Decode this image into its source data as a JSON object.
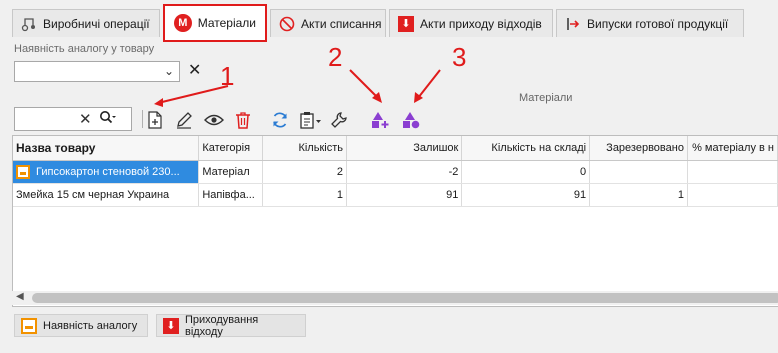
{
  "tabs": [
    {
      "label": "Виробничі операції",
      "icon": "process-icon"
    },
    {
      "label": "Матеріали",
      "icon": "materials-m-icon",
      "active": true
    },
    {
      "label": "Акти списання",
      "icon": "forbidden-icon"
    },
    {
      "label": "Акти приходу відходів",
      "icon": "red-down-arrow-icon"
    },
    {
      "label": "Випуски готової продукції",
      "icon": "release-icon"
    }
  ],
  "filter": {
    "label": "Наявність аналогу у товару",
    "value": ""
  },
  "grid": {
    "title": "Матеріали"
  },
  "columns": [
    "Назва товару",
    "Категорія",
    "Кількість",
    "Залишок",
    "Кількість на складі",
    "Зарезервовано",
    "% матеріалу в н"
  ],
  "rows": [
    {
      "name": "Гипсокартон стеновой 230...",
      "category": "Матеріал",
      "qty": "2",
      "rest": "-2",
      "stock": "0",
      "reserved": "",
      "pct": ""
    },
    {
      "name": "Змейка 15 см черная Украина",
      "category": "Напівфа...",
      "qty": "1",
      "rest": "91",
      "stock": "91",
      "reserved": "1",
      "pct": ""
    }
  ],
  "bottom": {
    "analog_label": "Наявність аналогу",
    "incoming_label": "Приходування відходу"
  },
  "annotations": {
    "a1": "1",
    "a2": "2",
    "a3": "3"
  },
  "colors": {
    "accent_red": "#e01b1b",
    "selection": "#2f8be0",
    "orange": "#f29200",
    "purple": "#8b3fd1"
  }
}
